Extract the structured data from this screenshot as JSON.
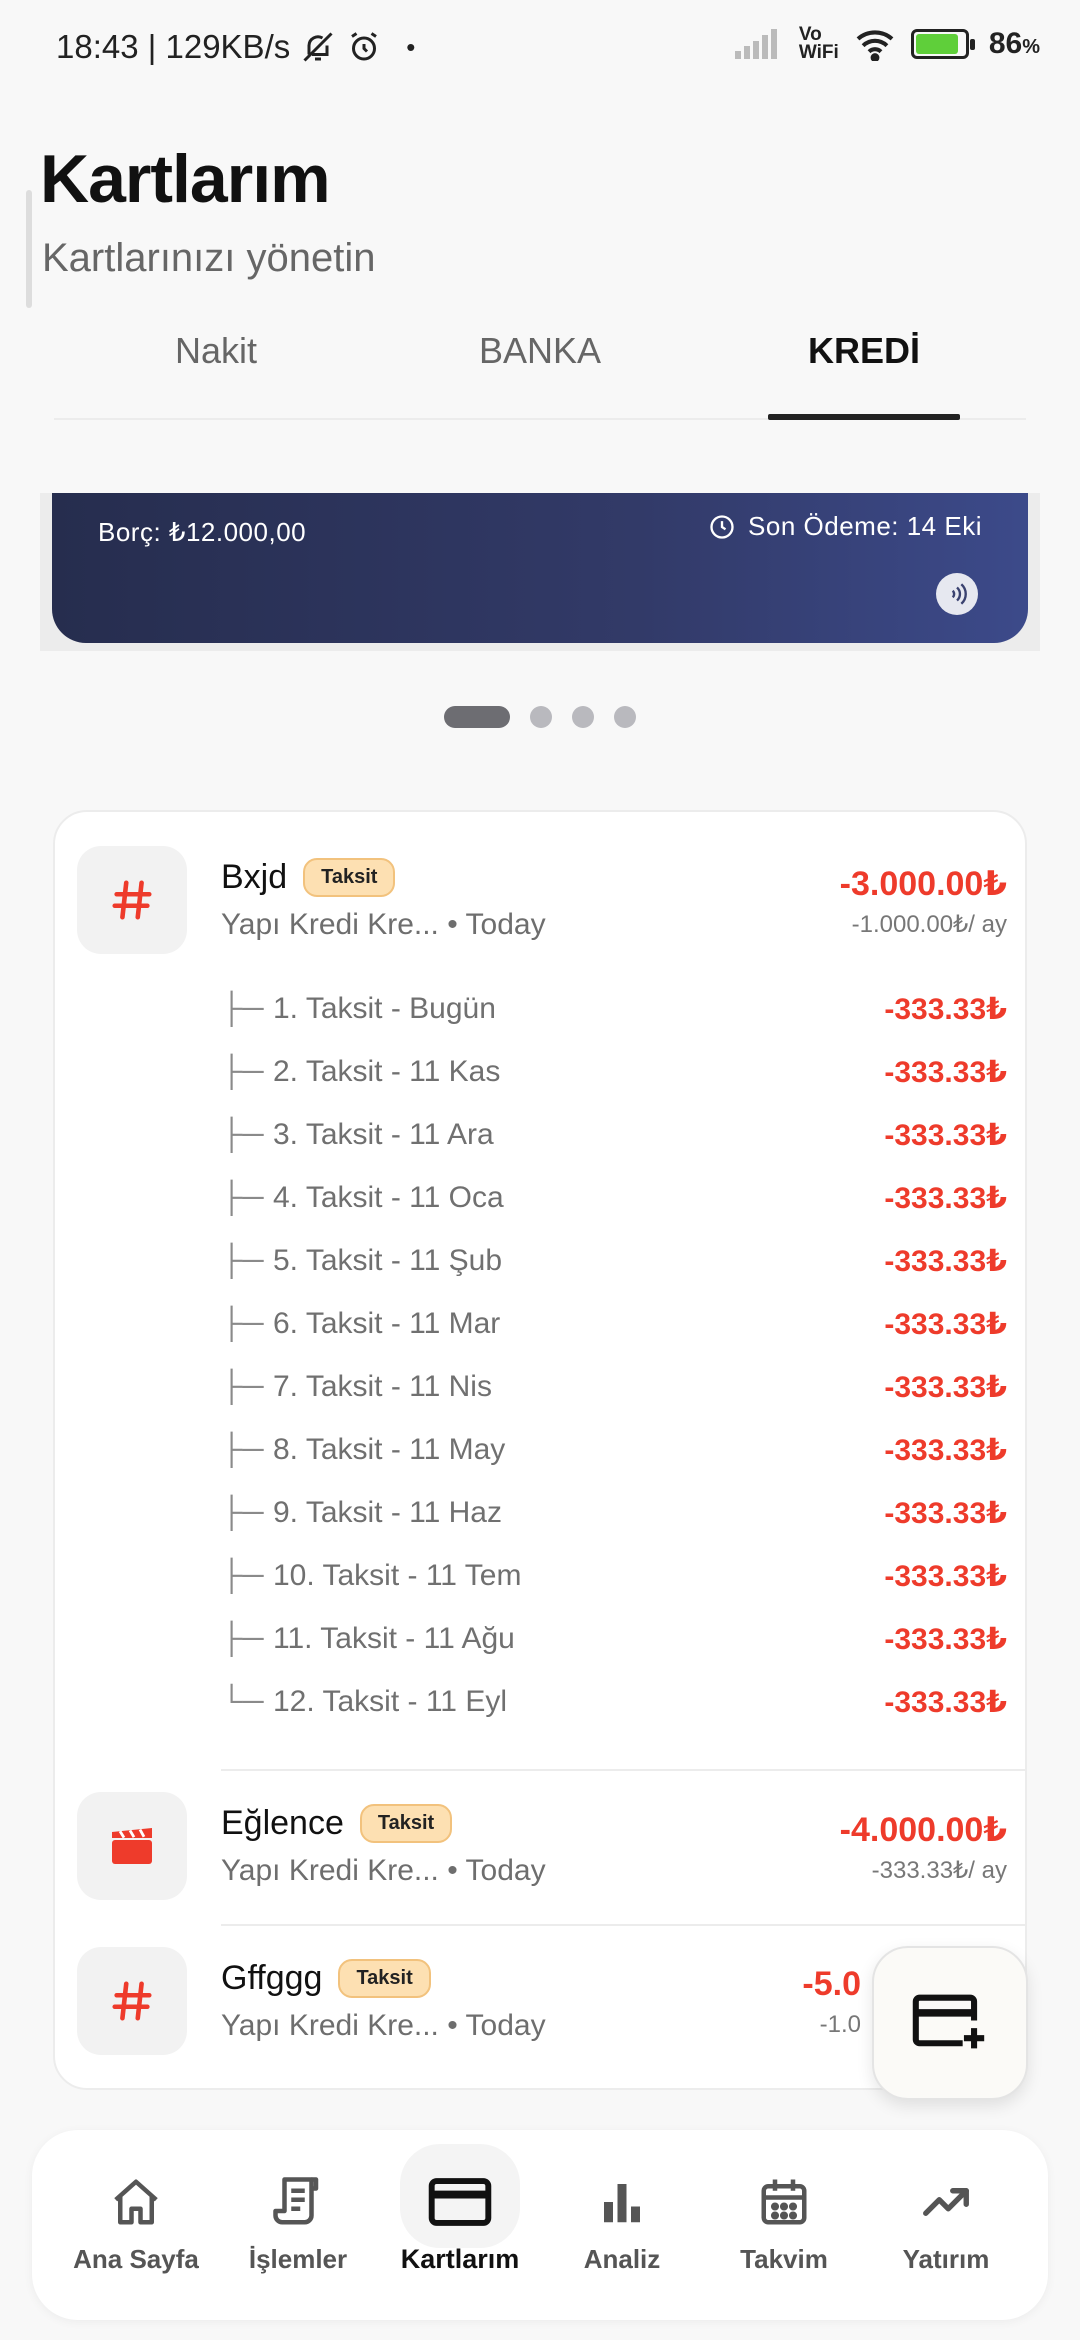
{
  "status_bar": {
    "time_speed": "18:43 | 129KB/s",
    "dot": "•",
    "vowifi_top": "Vo",
    "vowifi_bottom": "WiFi",
    "battery": "86",
    "battery_unit": "%",
    "icons": [
      "mute-bell-icon",
      "alarm-icon",
      "signal-icon",
      "wifi-icon",
      "battery-icon"
    ]
  },
  "header": {
    "title": "Kartlarım",
    "subtitle": "Kartlarınızı yönetin"
  },
  "tabs": [
    {
      "label": "Nakit",
      "active": false
    },
    {
      "label": "BANKA",
      "active": false
    },
    {
      "label": "KREDİ",
      "active": true
    }
  ],
  "card": {
    "debt": "Borç: ₺12.000,00",
    "due": "Son Ödeme: 14 Eki"
  },
  "carousel": {
    "count": 4,
    "active_index": 0
  },
  "transactions": [
    {
      "name": "Bxjd",
      "badge": "Taksit",
      "subtitle": "Yapı Kredi Kre... • Today",
      "amount": "-3.000.00₺",
      "monthly": "-1.000.00₺/ ay",
      "icon": "hash-icon",
      "installments": [
        {
          "tree": "├─",
          "label": "1. Taksit - Bugün",
          "amount": "-333.33₺"
        },
        {
          "tree": "├─",
          "label": "2. Taksit - 11 Kas",
          "amount": "-333.33₺"
        },
        {
          "tree": "├─",
          "label": "3. Taksit - 11 Ara",
          "amount": "-333.33₺"
        },
        {
          "tree": "├─",
          "label": "4. Taksit - 11 Oca",
          "amount": "-333.33₺"
        },
        {
          "tree": "├─",
          "label": "5. Taksit - 11 Şub",
          "amount": "-333.33₺"
        },
        {
          "tree": "├─",
          "label": "6. Taksit - 11 Mar",
          "amount": "-333.33₺"
        },
        {
          "tree": "├─",
          "label": "7. Taksit - 11 Nis",
          "amount": "-333.33₺"
        },
        {
          "tree": "├─",
          "label": "8. Taksit - 11 May",
          "amount": "-333.33₺"
        },
        {
          "tree": "├─",
          "label": "9. Taksit - 11 Haz",
          "amount": "-333.33₺"
        },
        {
          "tree": "├─",
          "label": "10. Taksit - 11 Tem",
          "amount": "-333.33₺"
        },
        {
          "tree": "├─",
          "label": "11. Taksit - 11 Ağu",
          "amount": "-333.33₺"
        },
        {
          "tree": "└─",
          "label": "12. Taksit - 11 Eyl",
          "amount": "-333.33₺"
        }
      ]
    },
    {
      "name": "Eğlence",
      "badge": "Taksit",
      "subtitle": "Yapı Kredi Kre... • Today",
      "amount": "-4.000.00₺",
      "monthly": "-333.33₺/ ay",
      "icon": "clapperboard-icon"
    },
    {
      "name": "Gffggg",
      "badge": "Taksit",
      "subtitle": "Yapı Kredi Kre... • Today",
      "amount": "-5.0",
      "monthly": "-1.0",
      "icon": "hash-icon"
    }
  ],
  "fab": {
    "icon": "add-card-icon"
  },
  "bottom_nav": [
    {
      "label": "Ana Sayfa",
      "icon": "home-icon",
      "active": false
    },
    {
      "label": "İşlemler",
      "icon": "receipt-icon",
      "active": false
    },
    {
      "label": "Kartlarım",
      "icon": "credit-card-icon",
      "active": true
    },
    {
      "label": "Analiz",
      "icon": "bar-chart-icon",
      "active": false
    },
    {
      "label": "Takvim",
      "icon": "calendar-icon",
      "active": false
    },
    {
      "label": "Yatırım",
      "icon": "trending-up-icon",
      "active": false
    }
  ],
  "colors": {
    "accent_red": "#ee3b2b",
    "card_dark": "#262d4e",
    "card_light": "#3c4a8a",
    "badge_bg": "#fde0b2"
  }
}
